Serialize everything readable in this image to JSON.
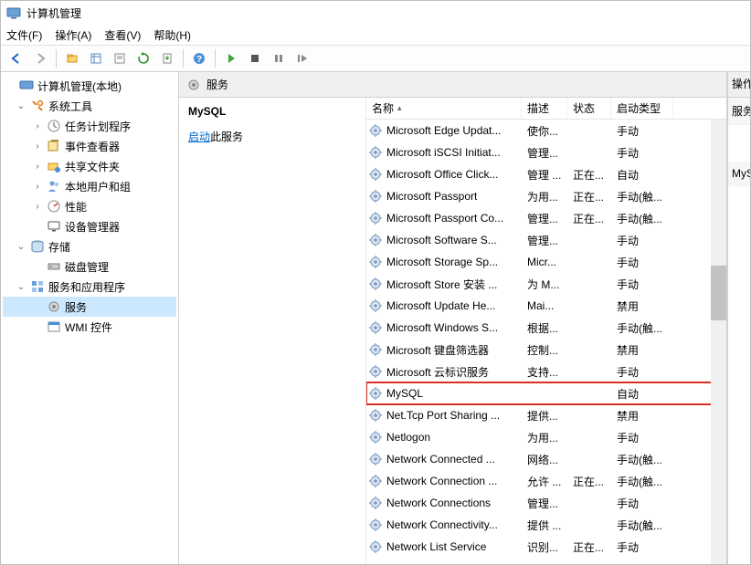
{
  "window": {
    "title": "计算机管理"
  },
  "menu": {
    "file": "文件(F)",
    "action": "操作(A)",
    "view": "查看(V)",
    "help": "帮助(H)"
  },
  "tree": {
    "root": "计算机管理(本地)",
    "system_tools": "系统工具",
    "task_scheduler": "任务计划程序",
    "event_viewer": "事件查看器",
    "shared_folders": "共享文件夹",
    "local_users": "本地用户和组",
    "performance": "性能",
    "device_manager": "设备管理器",
    "storage": "存储",
    "disk_mgmt": "磁盘管理",
    "services_apps": "服务和应用程序",
    "services": "服务",
    "wmi": "WMI 控件"
  },
  "panel": {
    "header": "服务",
    "selected_name": "MySQL",
    "action_link": "启动",
    "action_suffix": "此服务"
  },
  "columns": {
    "name": "名称",
    "desc": "描述",
    "state": "状态",
    "start": "启动类型"
  },
  "right": {
    "actions": "操作",
    "services": "服务",
    "selected": "MySQL"
  },
  "rows": [
    {
      "name": "Microsoft Edge Updat...",
      "desc": "使你...",
      "state": "",
      "start": "手动"
    },
    {
      "name": "Microsoft iSCSI Initiat...",
      "desc": "管理...",
      "state": "",
      "start": "手动"
    },
    {
      "name": "Microsoft Office Click...",
      "desc": "管理 ...",
      "state": "正在...",
      "start": "自动"
    },
    {
      "name": "Microsoft Passport",
      "desc": "为用...",
      "state": "正在...",
      "start": "手动(触..."
    },
    {
      "name": "Microsoft Passport Co...",
      "desc": "管理...",
      "state": "正在...",
      "start": "手动(触..."
    },
    {
      "name": "Microsoft Software S...",
      "desc": "管理...",
      "state": "",
      "start": "手动"
    },
    {
      "name": "Microsoft Storage Sp...",
      "desc": "Micr...",
      "state": "",
      "start": "手动"
    },
    {
      "name": "Microsoft Store 安装 ...",
      "desc": "为 M...",
      "state": "",
      "start": "手动"
    },
    {
      "name": "Microsoft Update He...",
      "desc": "Mai...",
      "state": "",
      "start": "禁用"
    },
    {
      "name": "Microsoft Windows S...",
      "desc": "根据...",
      "state": "",
      "start": "手动(触..."
    },
    {
      "name": "Microsoft 键盘筛选器",
      "desc": "控制...",
      "state": "",
      "start": "禁用"
    },
    {
      "name": "Microsoft 云标识服务",
      "desc": "支持...",
      "state": "",
      "start": "手动"
    },
    {
      "name": "MySQL",
      "desc": "",
      "state": "",
      "start": "自动",
      "highlight": true
    },
    {
      "name": "Net.Tcp Port Sharing ...",
      "desc": "提供...",
      "state": "",
      "start": "禁用"
    },
    {
      "name": "Netlogon",
      "desc": "为用...",
      "state": "",
      "start": "手动"
    },
    {
      "name": "Network Connected ...",
      "desc": "网络...",
      "state": "",
      "start": "手动(触..."
    },
    {
      "name": "Network Connection ...",
      "desc": "允许 ...",
      "state": "正在...",
      "start": "手动(触..."
    },
    {
      "name": "Network Connections",
      "desc": "管理...",
      "state": "",
      "start": "手动"
    },
    {
      "name": "Network Connectivity...",
      "desc": "提供 ...",
      "state": "",
      "start": "手动(触..."
    },
    {
      "name": "Network List Service",
      "desc": "识别...",
      "state": "正在...",
      "start": "手动"
    }
  ]
}
